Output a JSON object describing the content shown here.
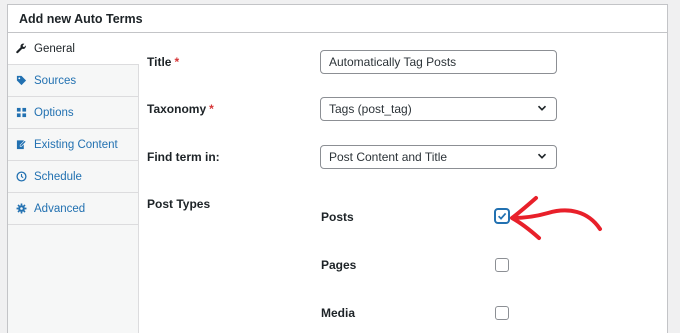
{
  "panel": {
    "title": "Add new Auto Terms"
  },
  "sidebar": {
    "items": [
      {
        "label": "General",
        "icon": "wrench-icon",
        "active": true
      },
      {
        "label": "Sources",
        "icon": "tag-icon"
      },
      {
        "label": "Options",
        "icon": "grid-icon"
      },
      {
        "label": "Existing Content",
        "icon": "edit-doc-icon"
      },
      {
        "label": "Schedule",
        "icon": "clock-icon"
      },
      {
        "label": "Advanced",
        "icon": "gear-icon"
      }
    ]
  },
  "form": {
    "title_label": "Title",
    "title_required": "*",
    "title_value": "Automatically Tag Posts",
    "taxonomy_label": "Taxonomy",
    "taxonomy_required": "*",
    "taxonomy_value": "Tags (post_tag)",
    "find_label": "Find term in:",
    "find_value": "Post Content and Title",
    "post_types_label": "Post Types",
    "post_types": [
      {
        "label": "Posts",
        "checked": true
      },
      {
        "label": "Pages",
        "checked": false
      },
      {
        "label": "Media",
        "checked": false
      }
    ]
  },
  "colors": {
    "accent": "#2271b1",
    "required": "#d63638",
    "annotation_arrow": "#e8202a"
  }
}
